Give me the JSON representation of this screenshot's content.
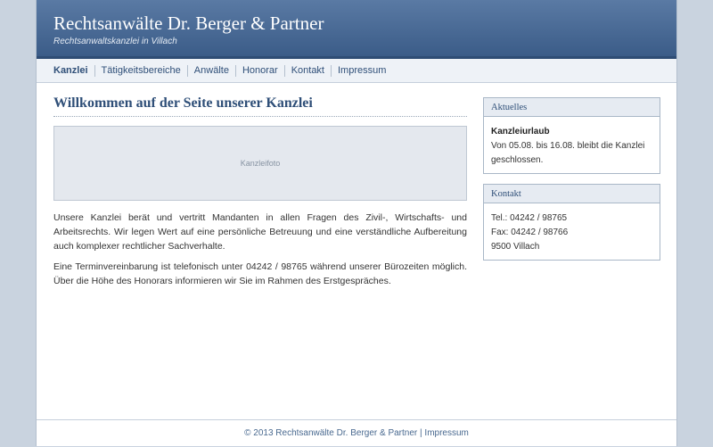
{
  "header": {
    "title": "Rechtsanwälte Dr. Berger & Partner",
    "subtitle": "Rechtsanwaltskanzlei in Villach"
  },
  "nav": {
    "items": [
      {
        "label": "Kanzlei",
        "active": true
      },
      {
        "label": "Tätigkeitsbereiche"
      },
      {
        "label": "Anwälte"
      },
      {
        "label": "Honorar"
      },
      {
        "label": "Kontakt"
      },
      {
        "label": "Impressum"
      }
    ]
  },
  "main": {
    "heading": "Willkommen auf der Seite unserer Kanzlei",
    "photo_label": "Kanzleifoto",
    "paragraphs": [
      "Unsere Kanzlei berät und vertritt Mandanten in allen Fragen des Zivil-, Wirtschafts- und Arbeitsrechts. Wir legen Wert auf eine persönliche Betreuung und eine verständliche Aufbereitung auch komplexer rechtlicher Sachverhalte.",
      "Eine Terminvereinbarung ist telefonisch unter 04242 / 98765 während unserer Bürozeiten möglich. Über die Höhe des Honorars informieren wir Sie im Rahmen des Erstgespräches."
    ]
  },
  "sidebar": {
    "news": {
      "title": "Aktuelles",
      "headline": "Kanzleiurlaub",
      "text": "Von 05.08. bis 16.08. bleibt die Kanzlei geschlossen."
    },
    "contact": {
      "title": "Kontakt",
      "phone": "Tel.: 04242 / 98765",
      "fax": "Fax: 04242 / 98766",
      "city": "9500 Villach"
    }
  },
  "footer": {
    "copyright": "© 2013 Rechtsanwälte Dr. Berger & Partner",
    "separator": "|",
    "link": "Impressum"
  }
}
